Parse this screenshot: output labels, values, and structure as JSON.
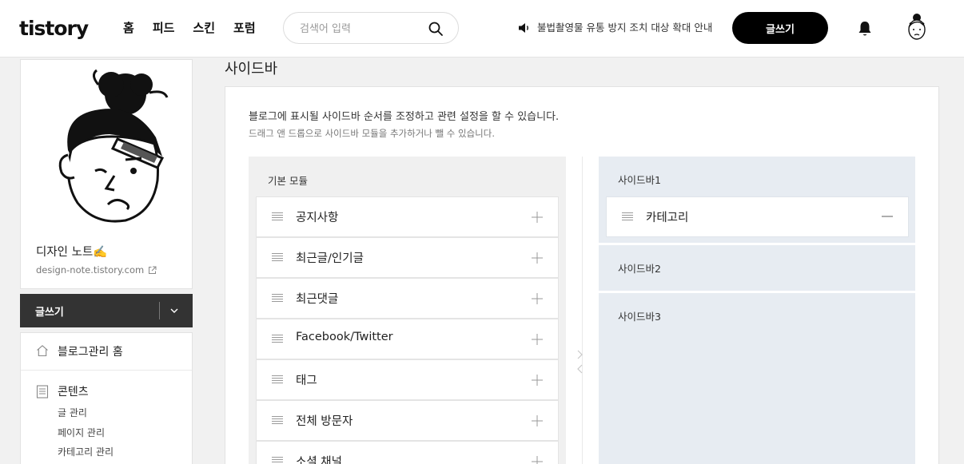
{
  "header": {
    "logo": "tistory",
    "nav": [
      "홈",
      "피드",
      "스킨",
      "포럼"
    ],
    "search_placeholder": "검색어 입력",
    "notice": "불법촬영물 유통 방지 조치 대상 확대 안내",
    "write_label": "글쓰기"
  },
  "profile": {
    "blog_name": "디자인 노트✍️",
    "blog_url": "design-note.tistory.com"
  },
  "sidebar_menu": {
    "write_label": "글쓰기",
    "home_label": "블로그관리 홈",
    "content_label": "콘텐츠",
    "content_items": [
      "글 관리",
      "페이지 관리",
      "카테고리 관리"
    ]
  },
  "page": {
    "title": "사이드바",
    "description": "블로그에 표시될 사이드바 순서를 조정하고 관련 설정을 할 수 있습니다.",
    "sub_description": "드래그 앤 드롭으로 사이드바 모듈을 추가하거나 뺄 수 있습니다."
  },
  "basic_modules": {
    "title": "기본 모듈",
    "items": [
      "공지사항",
      "최근글/인기글",
      "최근댓글",
      "Facebook/Twitter",
      "태그",
      "전체 방문자",
      "소셜 채널"
    ]
  },
  "sidebars": [
    {
      "title": "사이드바1",
      "items": [
        "카테고리"
      ]
    },
    {
      "title": "사이드바2",
      "items": []
    },
    {
      "title": "사이드바3",
      "items": []
    }
  ],
  "colors": {
    "accent": "#000000",
    "sidebar_panel_bg": "#e7ecf2",
    "basic_panel_bg": "#f0f0f0",
    "write_menu_bg": "#333333"
  }
}
